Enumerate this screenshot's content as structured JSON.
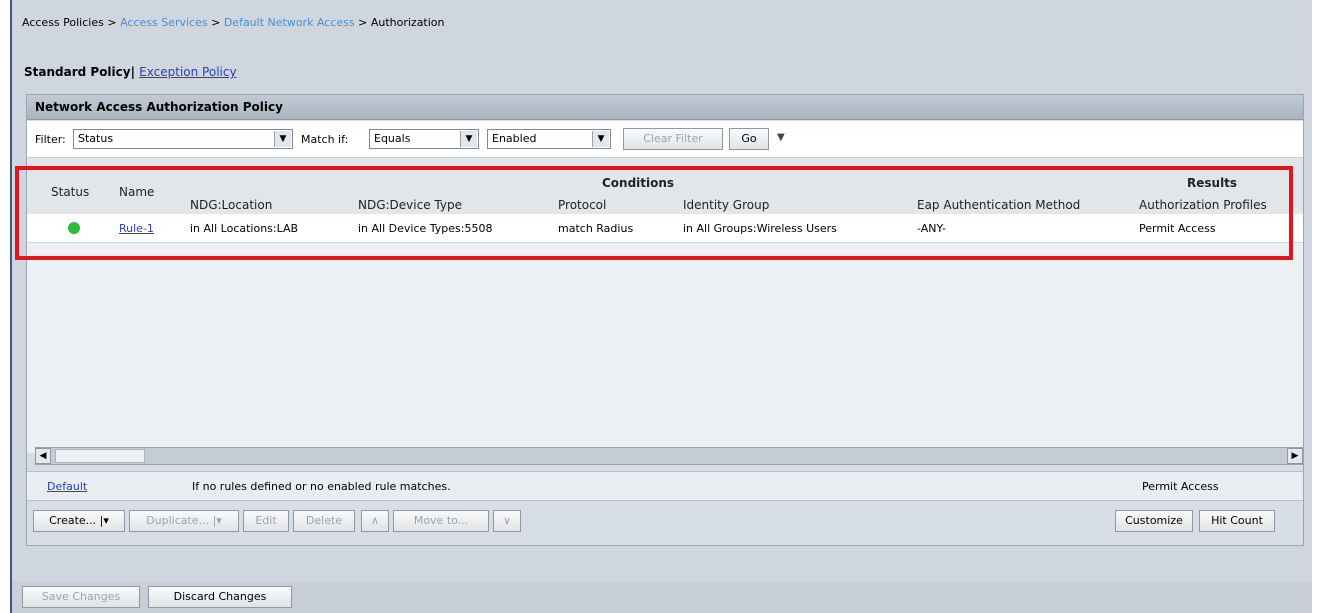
{
  "breadcrumb": [
    "Access Policies",
    "Access Services",
    "Default Network Access",
    "Authorization"
  ],
  "breadcrumb_sep": ">",
  "policy_tabs": {
    "standard": "Standard Policy",
    "separator": "|",
    "exception": "Exception Policy"
  },
  "panel_title": "Network Access Authorization Policy",
  "filter": {
    "filter_label": "Filter:",
    "filter_value": "Status",
    "match_label": "Match if:",
    "match_value": "Equals",
    "value_value": "Enabled",
    "clear_filter": "Clear Filter",
    "go": "Go"
  },
  "table": {
    "group_conditions": "Conditions",
    "group_results": "Results",
    "headers": {
      "status": "Status",
      "name": "Name",
      "ndg_location": "NDG:Location",
      "ndg_device_type": "NDG:Device Type",
      "protocol": "Protocol",
      "identity_group": "Identity Group",
      "eap_method": "Eap Authentication Method",
      "authz_profiles": "Authorization Profiles"
    },
    "rows": [
      {
        "status": "enabled",
        "name": "Rule-1",
        "ndg_location": "in All Locations:LAB",
        "ndg_device_type": "in All Device Types:5508",
        "protocol": "match Radius",
        "identity_group": "in All Groups:Wireless Users",
        "eap_method": "-ANY-",
        "authz_profiles": "Permit Access"
      }
    ]
  },
  "default_rule": {
    "name": "Default",
    "description": "If no rules defined or no enabled rule matches.",
    "result": "Permit Access"
  },
  "actions": {
    "create": "Create...",
    "duplicate": "Duplicate...",
    "edit": "Edit",
    "delete": "Delete",
    "move_to": "Move to...",
    "customize": "Customize",
    "hit_count": "Hit Count"
  },
  "footer": {
    "save": "Save Changes",
    "discard": "Discard Changes"
  },
  "colors": {
    "highlight": "#e2141c",
    "status_enabled": "#2fbb3b",
    "link": "#2a3fb8"
  }
}
